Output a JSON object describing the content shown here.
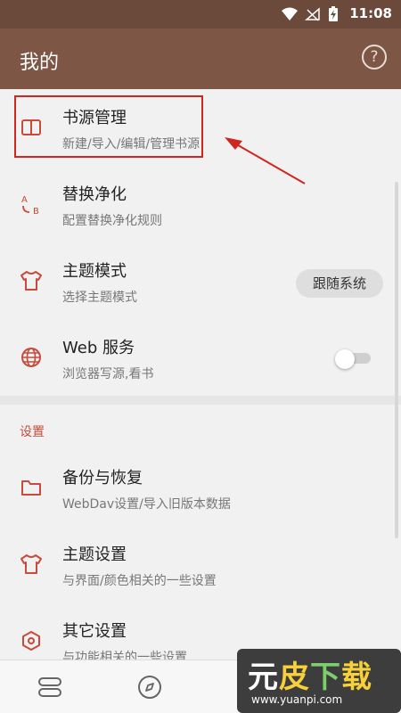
{
  "status_bar": {
    "time": "11:08"
  },
  "app_bar": {
    "title": "我的",
    "help_icon": "help-circle-icon"
  },
  "items_top": [
    {
      "title": "书源管理",
      "subtitle": "新建/导入/编辑/管理书源",
      "icon": "book-icon"
    },
    {
      "title": "替换净化",
      "subtitle": "配置替换净化规则",
      "icon": "replace-ab-icon"
    },
    {
      "title": "主题模式",
      "subtitle": "选择主题模式",
      "icon": "shirt-icon",
      "action_label": "跟随系统"
    },
    {
      "title": "Web 服务",
      "subtitle": "浏览器写源,看书",
      "icon": "globe-icon",
      "toggle_on": false
    }
  ],
  "settings_section": {
    "header": "设置",
    "items": [
      {
        "title": "备份与恢复",
        "subtitle": "WebDav设置/导入旧版本数据",
        "icon": "folder-icon"
      },
      {
        "title": "主题设置",
        "subtitle": "与界面/颜色相关的一些设置",
        "icon": "shirt-icon"
      },
      {
        "title": "其它设置",
        "subtitle": "与功能相关的一些设置",
        "icon": "settings-hex-icon"
      }
    ]
  },
  "bottom_nav": [
    "bookshelf-icon",
    "explore-compass-icon"
  ],
  "watermark": {
    "brand_1": "元",
    "brand_2": "皮",
    "brand_3": "下",
    "brand_4": "载",
    "url": "www.yuanpi.com"
  },
  "colors": {
    "appbar": "#7d5646",
    "statusbar": "#6b4a3b",
    "accent": "#c74a3a",
    "highlight": "#d0261e"
  }
}
